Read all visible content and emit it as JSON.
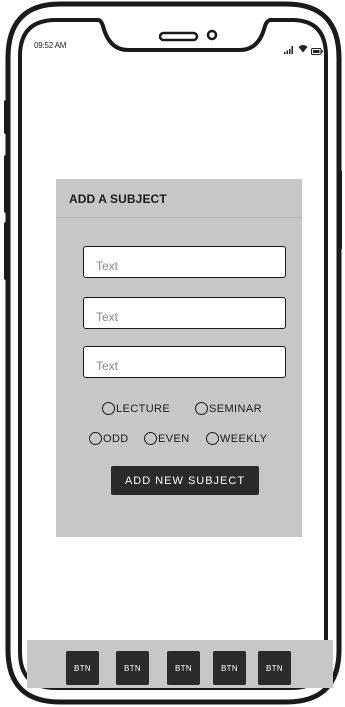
{
  "status_bar": {
    "time": "09:52 AM",
    "icons": [
      "signal-icon",
      "wifi-icon",
      "battery-icon"
    ]
  },
  "form": {
    "title": "ADD A SUBJECT",
    "inputs": [
      {
        "placeholder": "Text",
        "value": ""
      },
      {
        "placeholder": "Text",
        "value": ""
      },
      {
        "placeholder": "Text",
        "value": ""
      }
    ],
    "radio_type": [
      {
        "label": "LECTURE",
        "selected": false
      },
      {
        "label": "SEMINAR",
        "selected": false
      }
    ],
    "radio_frequency": [
      {
        "label": "ODD",
        "selected": false
      },
      {
        "label": "EVEN",
        "selected": false
      },
      {
        "label": "WEEKLY",
        "selected": false
      }
    ],
    "submit_label": "ADD NEW SUBJECT"
  },
  "bottom_nav": {
    "buttons": [
      "BTN",
      "BTN",
      "BTN",
      "BTN",
      "BTN"
    ]
  },
  "colors": {
    "panel": "#c7c7c7",
    "button": "#2a2a2a",
    "frame": "#1a1a1a"
  }
}
